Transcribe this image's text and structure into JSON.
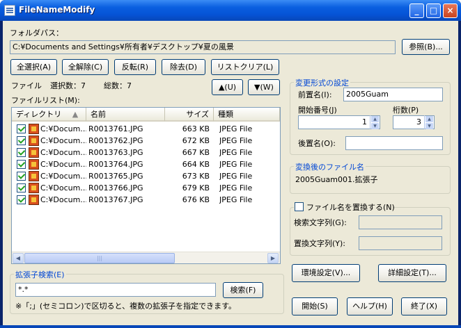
{
  "window": {
    "title": "FileNameModify"
  },
  "folder": {
    "label": "フォルダパス：",
    "path": "C:¥Documents and Settings¥所有者¥デスクトップ¥夏の風景",
    "browse_label": "参照(B)..."
  },
  "toolbar": {
    "select_all": "全選択(A)",
    "deselect_all": "全解除(C)",
    "invert": "反転(R)",
    "remove": "除去(D)",
    "list_clear": "リストクリア(L)"
  },
  "counts": {
    "file_label": "ファイル",
    "selected": "選択数：7",
    "total": "総数：7"
  },
  "move": {
    "up": "▲(U)",
    "down": "▼(W)"
  },
  "file_list": {
    "label": "ファイルリスト(M):",
    "columns": [
      "ディレクトリ",
      "名前",
      "サイズ",
      "種類"
    ],
    "sort_indicator": "▲",
    "rows": [
      {
        "dir": "C:¥Docum...",
        "name": "R0013761.JPG",
        "size": "663 KB",
        "type": "JPEG File",
        "checked": true
      },
      {
        "dir": "C:¥Docum...",
        "name": "R0013762.JPG",
        "size": "672 KB",
        "type": "JPEG File",
        "checked": true
      },
      {
        "dir": "C:¥Docum...",
        "name": "R0013763.JPG",
        "size": "667 KB",
        "type": "JPEG File",
        "checked": true
      },
      {
        "dir": "C:¥Docum...",
        "name": "R0013764.JPG",
        "size": "664 KB",
        "type": "JPEG File",
        "checked": true
      },
      {
        "dir": "C:¥Docum...",
        "name": "R0013765.JPG",
        "size": "673 KB",
        "type": "JPEG File",
        "checked": true
      },
      {
        "dir": "C:¥Docum...",
        "name": "R0013766.JPG",
        "size": "679 KB",
        "type": "JPEG File",
        "checked": true
      },
      {
        "dir": "C:¥Docum...",
        "name": "R0013767.JPG",
        "size": "676 KB",
        "type": "JPEG File",
        "checked": true
      }
    ]
  },
  "format": {
    "title": "変更形式の設定",
    "prefix_label": "前置名(I):",
    "prefix_value": "2005Guam",
    "start_label": "開始番号(J)",
    "start_value": "1",
    "digits_label": "桁数(P)",
    "digits_value": "3",
    "suffix_label": "後置名(O):",
    "suffix_value": ""
  },
  "preview": {
    "title": "変換後のファイル名",
    "value": "2005Guam001.拡張子"
  },
  "replace": {
    "title": "ファイル名を置換する(N)",
    "checked": false,
    "search_label": "検索文字列(G):",
    "replace_label": "置換文字列(Y):",
    "search_value": "",
    "replace_value": ""
  },
  "ext_search": {
    "title": "拡張子検索(E)",
    "value": "*.*",
    "button": "検索(F)",
    "note": "※「;」(セミコロン)で区切ると、複数の拡張子を指定できます。"
  },
  "actions": {
    "env": "環境設定(V)...",
    "detail": "詳細設定(T)...",
    "start": "開始(S)",
    "help": "ヘルプ(H)",
    "exit": "終了(X)"
  }
}
